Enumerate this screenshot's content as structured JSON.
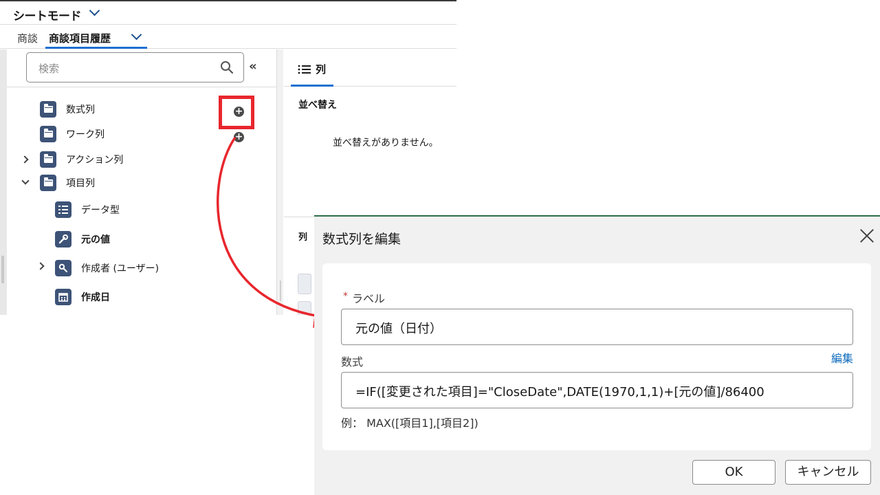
{
  "header": {
    "title": "シートモード"
  },
  "breadcrumb": {
    "object": "商談",
    "current": "商談項目履歴"
  },
  "search": {
    "placeholder": "検索"
  },
  "collapse_label": "«",
  "tree": {
    "formula_column": "数式列",
    "work_column": "ワーク列",
    "action_column": "アクション列",
    "field_column": "項目列",
    "data_type": "データ型",
    "original_value": "元の値",
    "created_by": "作成者 (ユーザー)",
    "created_date": "作成日"
  },
  "add_symbol": "+",
  "right_panel": {
    "columns_tab": "列",
    "sort_heading": "並べ替え",
    "no_sort": "並べ替えがありません。",
    "columns_label": "列"
  },
  "dialog": {
    "title": "数式列を編集",
    "required_mark": "*",
    "label_field_label": "ラベル",
    "label_value": "元の値（日付）",
    "formula_label": "数式",
    "edit_link": "編集",
    "formula_value": "=IF([変更された項目]=\"CloseDate\",DATE(1970,1,1)+[元の値]/86400",
    "example": "例： MAX([項目1],[項目2])",
    "ok_button": "OK",
    "cancel_button": "キャンセル"
  },
  "colors": {
    "accent": "#1b6fd0",
    "icon_bg": "#3d5377",
    "highlight": "#e8262d",
    "link": "#0f6cbd"
  }
}
